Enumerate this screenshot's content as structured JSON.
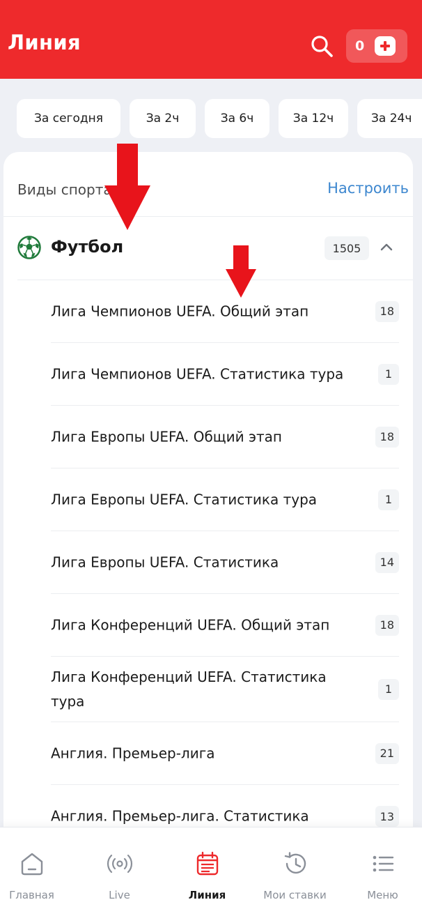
{
  "header": {
    "title": "Линия",
    "balance_count": "0",
    "accent": "#ee2a2c"
  },
  "filters": [
    "За сегодня",
    "За 2ч",
    "За 6ч",
    "За 12ч",
    "За 24ч"
  ],
  "sports_section": {
    "label": "Виды спорта",
    "configure_label": "Настроить"
  },
  "sport": {
    "name": "Футбол",
    "count": "1505",
    "icon": "soccer-ball-icon",
    "expanded": true
  },
  "leagues": [
    {
      "name": "Лига Чемпионов UEFA. Общий этап",
      "count": "18"
    },
    {
      "name": "Лига Чемпионов UEFA. Статистика тура",
      "count": "1"
    },
    {
      "name": "Лига Европы UEFA. Общий этап",
      "count": "18"
    },
    {
      "name": "Лига Европы UEFA. Статистика тура",
      "count": "1"
    },
    {
      "name": "Лига Европы UEFA. Статистика",
      "count": "14"
    },
    {
      "name": "Лига Конференций UEFA. Общий этап",
      "count": "18"
    },
    {
      "name": "Лига Конференций UEFA. Статистика тура",
      "count": "1"
    },
    {
      "name": "Англия. Премьер-лига",
      "count": "21"
    },
    {
      "name": "Англия. Премьер-лига. Статистика",
      "count": "13"
    }
  ],
  "tabbar": [
    {
      "label": "Главная",
      "icon": "home-icon"
    },
    {
      "label": "Live",
      "icon": "live-broadcast-icon"
    },
    {
      "label": "Линия",
      "icon": "calendar-icon",
      "active": true
    },
    {
      "label": "Мои ставки",
      "icon": "history-icon"
    },
    {
      "label": "Меню",
      "icon": "menu-list-icon"
    }
  ],
  "annotations": {
    "arrow_color": "#e8141b"
  }
}
